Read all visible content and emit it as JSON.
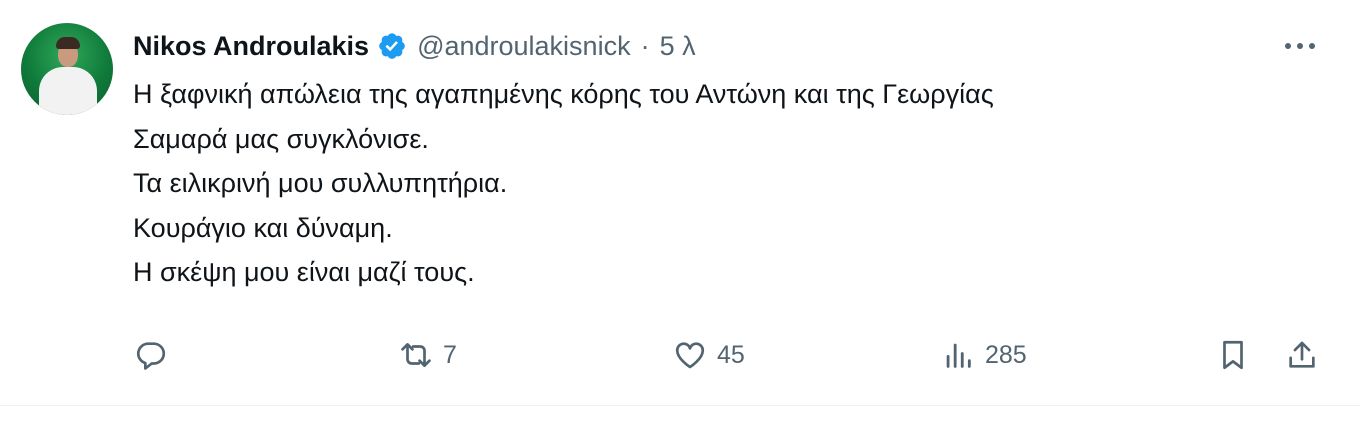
{
  "tweet": {
    "author_name": "Nikos Androulakis",
    "handle": "@androulakisnick",
    "separator": "·",
    "time": "5 λ",
    "text_lines": [
      "Η ξαφνική απώλεια της αγαπημένης κόρης του Αντώνη και της Γεωργίας",
      "Σαμαρά μας συγκλόνισε.",
      "Τα ειλικρινή μου συλλυπητήρια.",
      "Κουράγιο και δύναμη.",
      "Η σκέψη μου είναι μαζί τους."
    ]
  },
  "actions": {
    "reply_icon": "reply-icon",
    "retweet_icon": "retweet-icon",
    "retweet_count": "7",
    "like_icon": "heart-icon",
    "like_count": "45",
    "views_icon": "views-icon",
    "views_count": "285",
    "bookmark_icon": "bookmark-icon",
    "share_icon": "share-icon"
  },
  "colors": {
    "text": "#0f1419",
    "secondary": "#536471",
    "verified": "#1d9bf0"
  }
}
